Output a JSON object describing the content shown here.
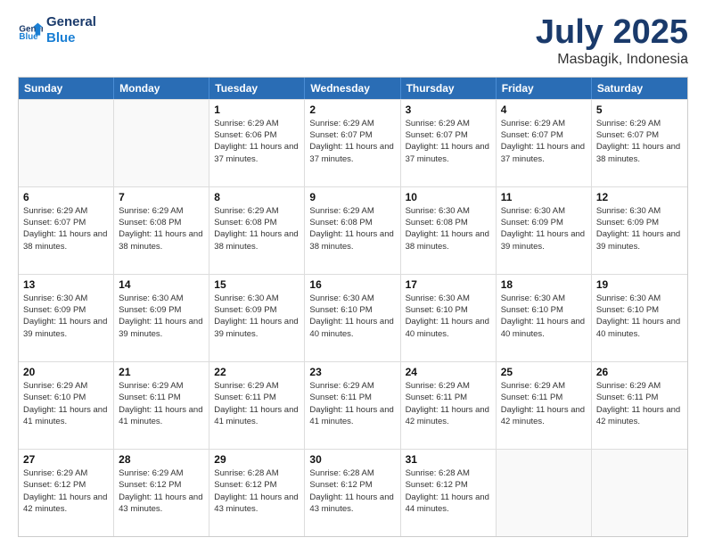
{
  "logo": {
    "text_general": "General",
    "text_blue": "Blue"
  },
  "title": "July 2025",
  "location": "Masbagik, Indonesia",
  "header_days": [
    "Sunday",
    "Monday",
    "Tuesday",
    "Wednesday",
    "Thursday",
    "Friday",
    "Saturday"
  ],
  "weeks": [
    [
      {
        "day": "",
        "empty": true
      },
      {
        "day": "",
        "empty": true
      },
      {
        "day": "1",
        "sunrise": "6:29 AM",
        "sunset": "6:06 PM",
        "daylight": "11 hours and 37 minutes."
      },
      {
        "day": "2",
        "sunrise": "6:29 AM",
        "sunset": "6:07 PM",
        "daylight": "11 hours and 37 minutes."
      },
      {
        "day": "3",
        "sunrise": "6:29 AM",
        "sunset": "6:07 PM",
        "daylight": "11 hours and 37 minutes."
      },
      {
        "day": "4",
        "sunrise": "6:29 AM",
        "sunset": "6:07 PM",
        "daylight": "11 hours and 37 minutes."
      },
      {
        "day": "5",
        "sunrise": "6:29 AM",
        "sunset": "6:07 PM",
        "daylight": "11 hours and 38 minutes."
      }
    ],
    [
      {
        "day": "6",
        "sunrise": "6:29 AM",
        "sunset": "6:07 PM",
        "daylight": "11 hours and 38 minutes."
      },
      {
        "day": "7",
        "sunrise": "6:29 AM",
        "sunset": "6:08 PM",
        "daylight": "11 hours and 38 minutes."
      },
      {
        "day": "8",
        "sunrise": "6:29 AM",
        "sunset": "6:08 PM",
        "daylight": "11 hours and 38 minutes."
      },
      {
        "day": "9",
        "sunrise": "6:29 AM",
        "sunset": "6:08 PM",
        "daylight": "11 hours and 38 minutes."
      },
      {
        "day": "10",
        "sunrise": "6:30 AM",
        "sunset": "6:08 PM",
        "daylight": "11 hours and 38 minutes."
      },
      {
        "day": "11",
        "sunrise": "6:30 AM",
        "sunset": "6:09 PM",
        "daylight": "11 hours and 39 minutes."
      },
      {
        "day": "12",
        "sunrise": "6:30 AM",
        "sunset": "6:09 PM",
        "daylight": "11 hours and 39 minutes."
      }
    ],
    [
      {
        "day": "13",
        "sunrise": "6:30 AM",
        "sunset": "6:09 PM",
        "daylight": "11 hours and 39 minutes."
      },
      {
        "day": "14",
        "sunrise": "6:30 AM",
        "sunset": "6:09 PM",
        "daylight": "11 hours and 39 minutes."
      },
      {
        "day": "15",
        "sunrise": "6:30 AM",
        "sunset": "6:09 PM",
        "daylight": "11 hours and 39 minutes."
      },
      {
        "day": "16",
        "sunrise": "6:30 AM",
        "sunset": "6:10 PM",
        "daylight": "11 hours and 40 minutes."
      },
      {
        "day": "17",
        "sunrise": "6:30 AM",
        "sunset": "6:10 PM",
        "daylight": "11 hours and 40 minutes."
      },
      {
        "day": "18",
        "sunrise": "6:30 AM",
        "sunset": "6:10 PM",
        "daylight": "11 hours and 40 minutes."
      },
      {
        "day": "19",
        "sunrise": "6:30 AM",
        "sunset": "6:10 PM",
        "daylight": "11 hours and 40 minutes."
      }
    ],
    [
      {
        "day": "20",
        "sunrise": "6:29 AM",
        "sunset": "6:10 PM",
        "daylight": "11 hours and 41 minutes."
      },
      {
        "day": "21",
        "sunrise": "6:29 AM",
        "sunset": "6:11 PM",
        "daylight": "11 hours and 41 minutes."
      },
      {
        "day": "22",
        "sunrise": "6:29 AM",
        "sunset": "6:11 PM",
        "daylight": "11 hours and 41 minutes."
      },
      {
        "day": "23",
        "sunrise": "6:29 AM",
        "sunset": "6:11 PM",
        "daylight": "11 hours and 41 minutes."
      },
      {
        "day": "24",
        "sunrise": "6:29 AM",
        "sunset": "6:11 PM",
        "daylight": "11 hours and 42 minutes."
      },
      {
        "day": "25",
        "sunrise": "6:29 AM",
        "sunset": "6:11 PM",
        "daylight": "11 hours and 42 minutes."
      },
      {
        "day": "26",
        "sunrise": "6:29 AM",
        "sunset": "6:11 PM",
        "daylight": "11 hours and 42 minutes."
      }
    ],
    [
      {
        "day": "27",
        "sunrise": "6:29 AM",
        "sunset": "6:12 PM",
        "daylight": "11 hours and 42 minutes."
      },
      {
        "day": "28",
        "sunrise": "6:29 AM",
        "sunset": "6:12 PM",
        "daylight": "11 hours and 43 minutes."
      },
      {
        "day": "29",
        "sunrise": "6:28 AM",
        "sunset": "6:12 PM",
        "daylight": "11 hours and 43 minutes."
      },
      {
        "day": "30",
        "sunrise": "6:28 AM",
        "sunset": "6:12 PM",
        "daylight": "11 hours and 43 minutes."
      },
      {
        "day": "31",
        "sunrise": "6:28 AM",
        "sunset": "6:12 PM",
        "daylight": "11 hours and 44 minutes."
      },
      {
        "day": "",
        "empty": true
      },
      {
        "day": "",
        "empty": true
      }
    ]
  ]
}
